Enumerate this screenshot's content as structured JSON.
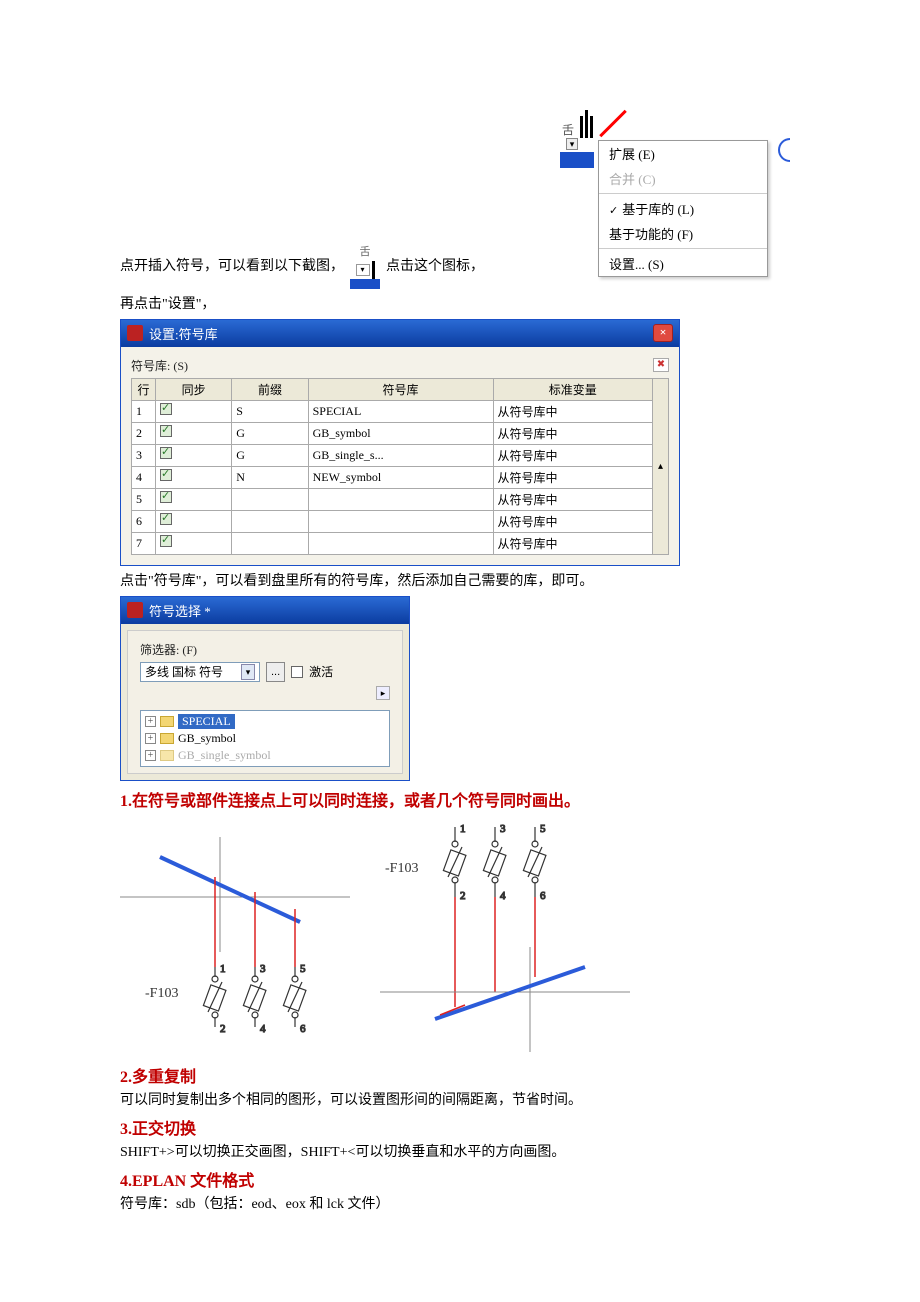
{
  "ctx_menu": {
    "tab_char": "舌",
    "items": {
      "extend": "扩展 (E)",
      "merge": "合并 (C)",
      "based_lib": "基于库的 (L)",
      "based_func": "基于功能的 (F)",
      "settings": "设置... (S)"
    }
  },
  "intro": {
    "line1a": "点开插入符号，可以看到以下截图，",
    "mini_label": "舌",
    "line1b": "点击这个图标，",
    "line2": "再点击\"设置\"，"
  },
  "dialog_settings": {
    "title": "设置:符号库",
    "lib_label": "符号库: (S)",
    "cols": {
      "row": "行",
      "sync": "同步",
      "prefix": "前缀",
      "symlib": "符号库",
      "stdvar": "标准变量"
    },
    "rows": [
      {
        "n": "1",
        "prefix": "S",
        "lib": "SPECIAL",
        "std": "从符号库中"
      },
      {
        "n": "2",
        "prefix": "G",
        "lib": "GB_symbol",
        "std": "从符号库中"
      },
      {
        "n": "3",
        "prefix": "G",
        "lib": "GB_single_s...",
        "std": "从符号库中"
      },
      {
        "n": "4",
        "prefix": "N",
        "lib": "NEW_symbol",
        "std": "从符号库中"
      },
      {
        "n": "5",
        "prefix": "",
        "lib": "",
        "std": "从符号库中"
      },
      {
        "n": "6",
        "prefix": "",
        "lib": "",
        "std": "从符号库中"
      },
      {
        "n": "7",
        "prefix": "",
        "lib": "",
        "std": "从符号库中"
      }
    ]
  },
  "after_table": "点击\"符号库\"，可以看到盘里所有的符号库，然后添加自己需要的库，即可。",
  "dialog_symbol": {
    "title": "符号选择 *",
    "filter_label": "筛选器: (F)",
    "combo_value": "多线 国标 符号",
    "chk_label": "激活",
    "tree": {
      "item1": "SPECIAL",
      "item2": "GB_symbol",
      "item3": "GB_single_symbol"
    }
  },
  "heading1": "1.在符号或部件连接点上可以同时连接，或者几个符号同时画出。",
  "diag": {
    "label_f103": "-F103",
    "n1": "1",
    "n2": "2",
    "n3": "3",
    "n4": "4",
    "n5": "5",
    "n6": "6"
  },
  "heading2": "2.多重复制",
  "body2": "可以同时复制出多个相同的图形，可以设置图形间的间隔距离，节省时间。",
  "heading3": "3.正交切换",
  "body3": "SHIFT+>可以切换正交画图，SHIFT+<可以切换垂直和水平的方向画图。",
  "heading4": "4.EPLAN 文件格式",
  "body4": "符号库：sdb（包括：eod、eox 和 lck 文件）"
}
